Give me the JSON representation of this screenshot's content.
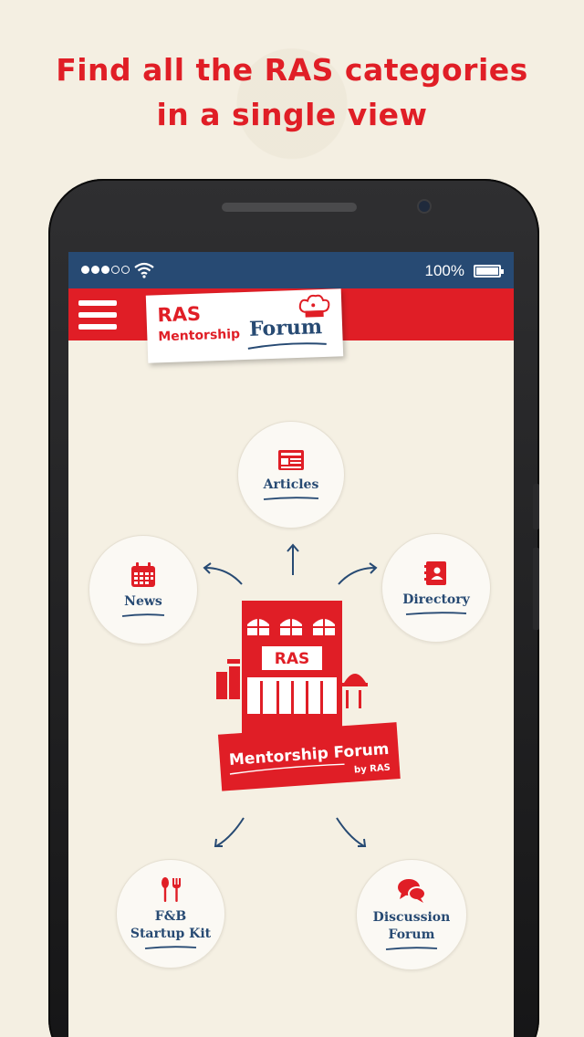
{
  "headline": {
    "line1": "Find all the RAS categories",
    "line2": "in a single view"
  },
  "status_bar": {
    "battery_text": "100%"
  },
  "app_bar": {
    "logo_ras": "RAS",
    "logo_mentorship": "Mentorship",
    "logo_forum": "Forum"
  },
  "categories": {
    "articles": "Articles",
    "news": "News",
    "directory": "Directory",
    "fb_startup_kit": "F&B\nStartup Kit",
    "discussion_forum": "Discussion\nForum"
  },
  "center_logo": {
    "building_sign": "RAS",
    "banner_title": "Mentorship Forum",
    "banner_sub": "by RAS"
  },
  "colors": {
    "brand_red": "#e01e26",
    "brand_blue": "#274a73",
    "background": "#f4efe2"
  },
  "icons": [
    "menu-icon",
    "wifi-icon",
    "battery-icon",
    "articles-icon",
    "calendar-icon",
    "directory-icon",
    "cutlery-icon",
    "chat-bubbles-icon",
    "chef-hat-icon"
  ]
}
